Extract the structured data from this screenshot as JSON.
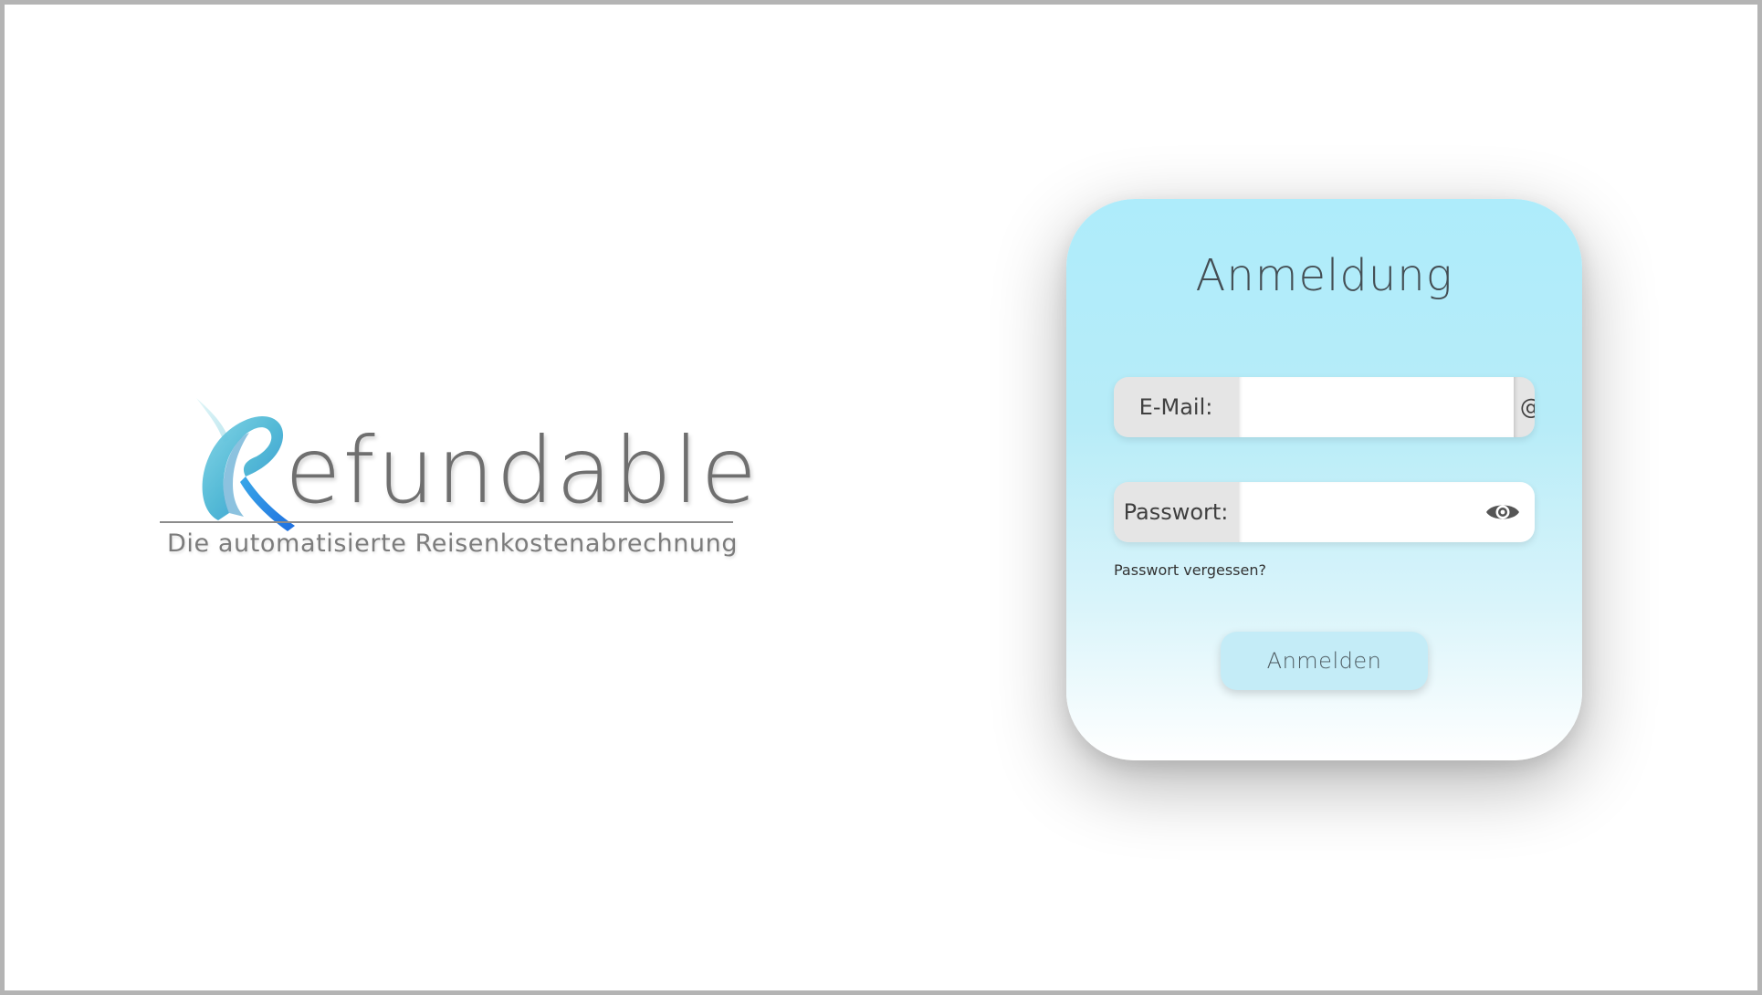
{
  "brand": {
    "logo_text": "efundable",
    "logo_initial": "R",
    "tagline": "Die automatisierte Reisenkostenabrechnung"
  },
  "login": {
    "title": "Anmeldung",
    "email": {
      "label": "E-Mail:",
      "value": "",
      "placeholder": "",
      "suffix": "@tgm.ac.at"
    },
    "password": {
      "label": "Passwort:",
      "value": "",
      "placeholder": "",
      "toggle_icon": "eye-icon"
    },
    "forgot_password_label": "Passwort vergessen?",
    "submit_label": "Anmelden"
  },
  "colors": {
    "card_gradient_top": "#aeecfb",
    "card_gradient_bottom": "#ffffff",
    "button_background": "#c4ecf7",
    "field_label_background": "#e5e5e5",
    "logo_blue_light": "#5ac0d8",
    "logo_blue_dark": "#2a7fe0",
    "logo_text": "#6f6f6f"
  }
}
